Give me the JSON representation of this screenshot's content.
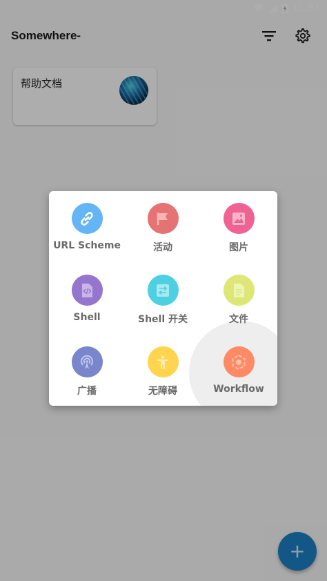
{
  "status_bar": {
    "time": "11:53"
  },
  "app_bar": {
    "title": "Somewhere-",
    "filter_icon": "filter-icon",
    "settings_icon": "gear-icon"
  },
  "card": {
    "title": "帮助文档",
    "avatar_icon": "globe-avatar"
  },
  "menu": {
    "items": [
      {
        "label": "URL Scheme",
        "icon": "link-icon",
        "color": "#64b5f6"
      },
      {
        "label": "活动",
        "icon": "flag-icon",
        "color": "#e57373"
      },
      {
        "label": "图片",
        "icon": "image-icon",
        "color": "#f06292"
      },
      {
        "label": "Shell",
        "icon": "code-icon",
        "color": "#9575cd"
      },
      {
        "label": "Shell 开关",
        "icon": "switch-icon",
        "color": "#4dd0e1"
      },
      {
        "label": "文件",
        "icon": "file-icon",
        "color": "#dce775"
      },
      {
        "label": "广播",
        "icon": "broadcast-icon",
        "color": "#7986cb"
      },
      {
        "label": "无障碍",
        "icon": "accessibility-icon",
        "color": "#ffd54f"
      },
      {
        "label": "Workflow",
        "icon": "workflow-icon",
        "color": "#ff8a65"
      }
    ]
  },
  "fab": {
    "label": "+"
  }
}
